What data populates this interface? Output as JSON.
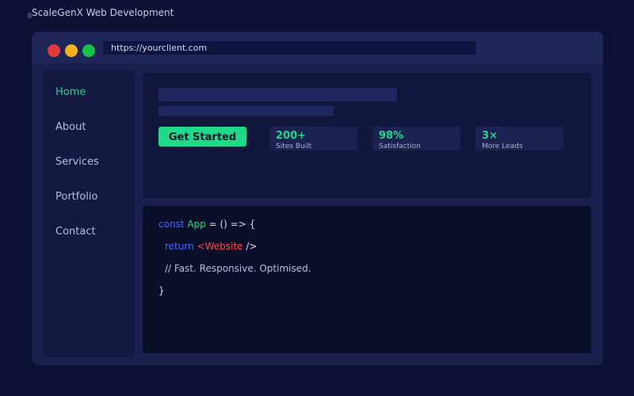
{
  "app": {
    "title": "ScaleGenX Web Development"
  },
  "browser": {
    "url": "https://yourclient.com",
    "traffic_lights": {
      "close": "#e23b3b",
      "minimize": "#f5b21a",
      "maximize": "#16c24a"
    }
  },
  "sidebar": {
    "items": [
      {
        "label": "Home",
        "active": true
      },
      {
        "label": "About",
        "active": false
      },
      {
        "label": "Services",
        "active": false
      },
      {
        "label": "Portfolio",
        "active": false
      },
      {
        "label": "Contact",
        "active": false
      }
    ]
  },
  "hero": {
    "cta_label": "Get Started",
    "stats": [
      {
        "value": "200+",
        "label": "Sites Built"
      },
      {
        "value": "98%",
        "label": "Satisfaction"
      },
      {
        "value": "3×",
        "label": "More Leads"
      }
    ]
  },
  "code": {
    "line1": {
      "kw": "const",
      "name": "App",
      "rest": " = () => {"
    },
    "line2": {
      "kw": "return",
      "tag": "<Website",
      "rest": " />"
    },
    "line3": "// Fast. Responsive. Optimised.",
    "line4": "}"
  },
  "colors": {
    "accent": "#1ed98a",
    "background": "#0d1033",
    "keyword": "#3b6dff",
    "tag": "#ff4a4a"
  }
}
